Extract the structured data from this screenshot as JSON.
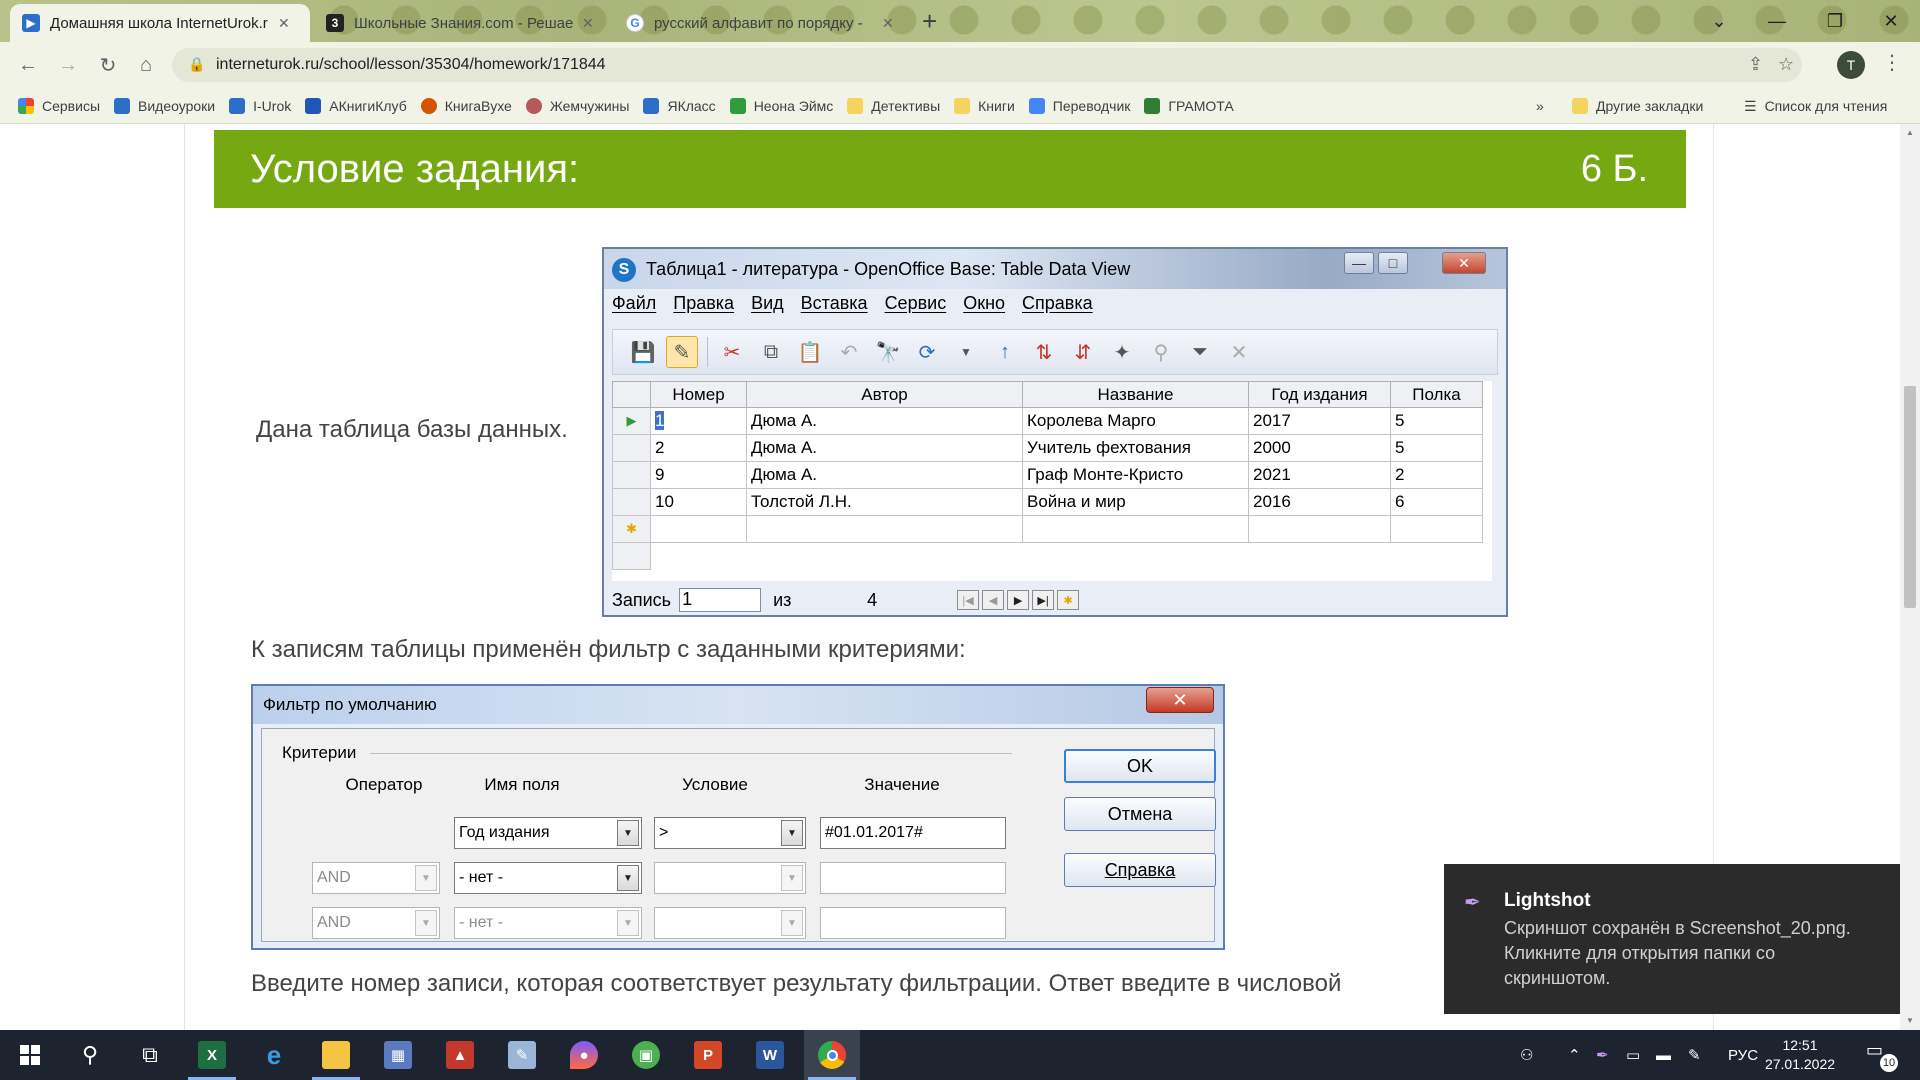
{
  "browser": {
    "tabs": [
      {
        "title": "Домашняя школа InternetUrok.r",
        "favicon": "internet-urok-icon",
        "active": true
      },
      {
        "title": "Школьные Знания.com - Решае",
        "favicon": "znania-icon",
        "active": false
      },
      {
        "title": "русский алфавит по порядку - ",
        "favicon": "google-icon",
        "active": false
      }
    ],
    "url": "interneturok.ru/school/lesson/35304/homework/171844",
    "profile_initial": "T",
    "bookmarks": [
      {
        "label": "Сервисы",
        "icon": "apps-grid-icon"
      },
      {
        "label": "Видеоуроки",
        "icon": "play-icon"
      },
      {
        "label": "I-Urok",
        "icon": "play-icon"
      },
      {
        "label": "АКнигиКлуб",
        "icon": "megaphone-icon"
      },
      {
        "label": "КнигаВухе",
        "icon": "book-icon"
      },
      {
        "label": "Жемчужины",
        "icon": "pearl-icon"
      },
      {
        "label": "ЯКласс",
        "icon": "play-icon"
      },
      {
        "label": "Неона Эймс",
        "icon": "green-book-icon"
      },
      {
        "label": "Детективы",
        "icon": "folder-icon"
      },
      {
        "label": "Книги",
        "icon": "folder-icon"
      },
      {
        "label": "Переводчик",
        "icon": "translate-icon"
      },
      {
        "label": "ГРАМОТА",
        "icon": "gramota-icon"
      }
    ],
    "more_bookmarks": "»",
    "other_bookmarks": "Другие закладки",
    "reading_list": "Список для чтения"
  },
  "task": {
    "banner_title": "Условие задания:",
    "points": "6 Б.",
    "intro": "Дана таблица базы данных.",
    "filter_text": "К записям таблицы применён фильтр с заданными критериями:",
    "question": "Введите номер записи, которая соответствует результату фильтрации. Ответ введите в числовой"
  },
  "oo_window": {
    "title": "Таблица1 - литература - OpenOffice Base: Table Data View",
    "menu": [
      "Файл",
      "Правка",
      "Вид",
      "Вставка",
      "Сервис",
      "Окно",
      "Справка"
    ],
    "columns": [
      "Номер",
      "Автор",
      "Название",
      "Год издания",
      "Полка"
    ],
    "rows": [
      [
        "1",
        "Дюма А.",
        "Королева Марго",
        "2017",
        "5"
      ],
      [
        "2",
        "Дюма А.",
        "Учитель фехтования",
        "2000",
        "5"
      ],
      [
        "9",
        "Дюма А.",
        "Граф Монте-Кристо",
        "2021",
        "2"
      ],
      [
        "10",
        "Толстой Л.Н.",
        "Война и мир",
        "2016",
        "6"
      ]
    ],
    "status": {
      "record_label": "Запись",
      "record_value": "1",
      "of_label": "из",
      "total": "4"
    }
  },
  "filter_dialog": {
    "title": "Фильтр по умолчанию",
    "group": "Критерии",
    "headers": {
      "operator": "Оператор",
      "field": "Имя поля",
      "condition": "Условие",
      "value": "Значение"
    },
    "rows": [
      {
        "operator": "",
        "field": "Год издания",
        "condition": ">",
        "value": "#01.01.2017#"
      },
      {
        "operator": "AND",
        "field": "- нет -",
        "condition": "",
        "value": ""
      },
      {
        "operator": "AND",
        "field": "- нет -",
        "condition": "",
        "value": ""
      }
    ],
    "buttons": {
      "ok": "OK",
      "cancel": "Отмена",
      "help": "Справка"
    }
  },
  "toast": {
    "app": "Lightshot",
    "message": "Скриншот сохранён в Screenshot_20.png. Кликните для открытия папки со скриншотом."
  },
  "taskbar": {
    "language": "РУС",
    "time": "12:51",
    "date": "27.01.2022",
    "notification_count": "10"
  }
}
